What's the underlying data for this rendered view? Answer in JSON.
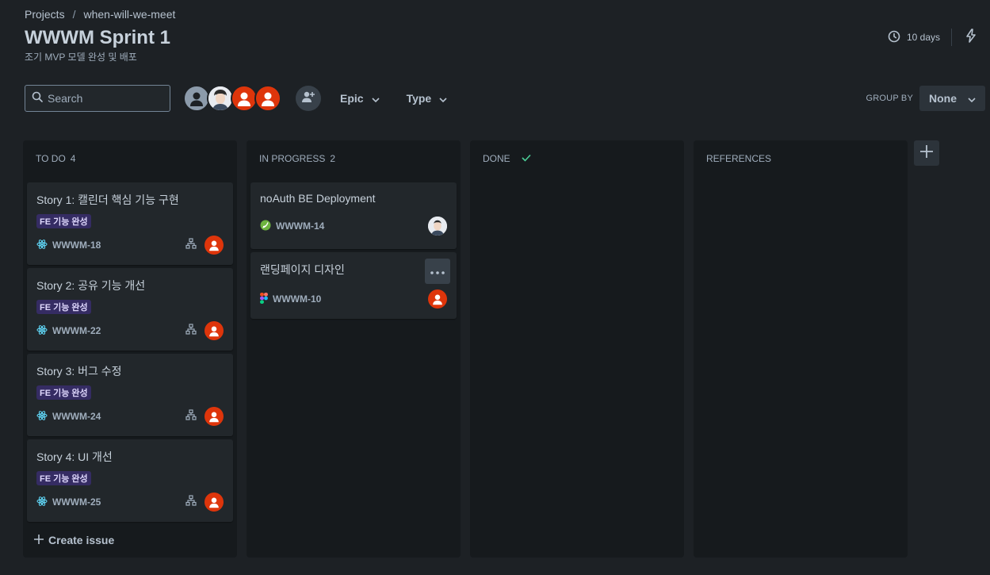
{
  "breadcrumb": {
    "projects": "Projects",
    "separator": "/",
    "project": "when-will-we-meet"
  },
  "sprint": {
    "title": "WWWM Sprint 1",
    "subtitle": "조기 MVP 모델 완성 및 배포",
    "days": "10 days"
  },
  "toolbar": {
    "search_placeholder": "Search",
    "filters": [
      "Epic",
      "Type"
    ],
    "group_by_label": "GROUP BY",
    "group_by_value": "None"
  },
  "columns": {
    "todo": {
      "name": "TO DO",
      "count": "4",
      "create_label": "Create issue"
    },
    "in_progress": {
      "name": "IN PROGRESS",
      "count": "2"
    },
    "done": {
      "name": "DONE"
    },
    "references": {
      "name": "REFERENCES"
    }
  },
  "todo_cards": [
    {
      "title": "Story 1: 캘린더 핵심 기능 구현",
      "tag": "FE 기능 완성",
      "key": "WWWM-18",
      "icon": "react-icon"
    },
    {
      "title": "Story 2: 공유 기능 개선",
      "tag": "FE 기능 완성",
      "key": "WWWM-22",
      "icon": "react-icon"
    },
    {
      "title": "Story 3: 버그 수정",
      "tag": "FE 기능 완성",
      "key": "WWWM-24",
      "icon": "react-icon"
    },
    {
      "title": "Story 4: UI 개선",
      "tag": "FE 기능 완성",
      "key": "WWWM-25",
      "icon": "react-icon"
    }
  ],
  "progress_cards": [
    {
      "title": "noAuth BE Deployment",
      "key": "WWWM-14",
      "icon": "spring-icon"
    },
    {
      "title": "랜딩페이지 디자인",
      "key": "WWWM-10",
      "icon": "figma-icon"
    }
  ],
  "colors": {
    "background": "#1d2125",
    "column": "#161a1d",
    "card": "#22272b",
    "tag_bg": "#352c63",
    "avatar_orange": "#de350b",
    "done_check": "#4bce97"
  }
}
